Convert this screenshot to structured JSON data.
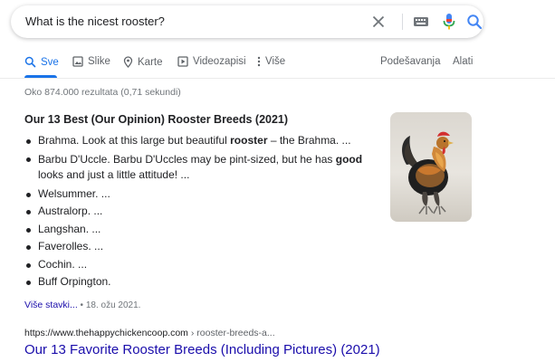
{
  "search": {
    "query": "What is the nicest rooster?"
  },
  "tabs": [
    {
      "label": "Sve",
      "icon": "search-icon",
      "active": true
    },
    {
      "label": "Slike",
      "icon": "image-icon",
      "active": false
    },
    {
      "label": "Karte",
      "icon": "map-pin-icon",
      "active": false
    },
    {
      "label": "Videozapisi",
      "icon": "video-icon",
      "active": false
    },
    {
      "label": "Više",
      "icon": "more-vert-icon",
      "active": false
    }
  ],
  "toolbar": {
    "settings_label": "Podešavanja",
    "tools_label": "Alati"
  },
  "result_stats": "Oko 874.000 rezultata (0,71 sekundi)",
  "featured_snippet": {
    "title": "Our 13 Best (Our Opinion) Rooster Breeds (2021)",
    "items": [
      {
        "before": "Brahma. Look at this large but beautiful ",
        "bold": "rooster",
        "after": " – the Brahma. ..."
      },
      {
        "before": "Barbu D'Uccle. Barbu D'Uccles may be pint-sized, but he has ",
        "bold": "good",
        "after": " looks and just a little attitude! ..."
      },
      {
        "before": "Welsummer. ...",
        "bold": "",
        "after": ""
      },
      {
        "before": "Australorp. ...",
        "bold": "",
        "after": ""
      },
      {
        "before": "Langshan. ...",
        "bold": "",
        "after": ""
      },
      {
        "before": "Faverolles. ...",
        "bold": "",
        "after": ""
      },
      {
        "before": "Cochin. ...",
        "bold": "",
        "after": ""
      },
      {
        "before": "Buff Orpington.",
        "bold": "",
        "after": ""
      }
    ],
    "more_label": "Više stavki...",
    "separator": "•",
    "date": "18. ožu 2021."
  },
  "result": {
    "url_domain": "https://www.thehappychickencoop.com",
    "url_path": " › rooster-breeds-a...",
    "title": "Our 13 Favorite Rooster Breeds (Including Pictures) (2021)"
  },
  "colors": {
    "link_blue": "#1a0dab",
    "accent_blue": "#1a73e8",
    "mic_red": "#ea4335",
    "gray_text": "#70757a"
  }
}
